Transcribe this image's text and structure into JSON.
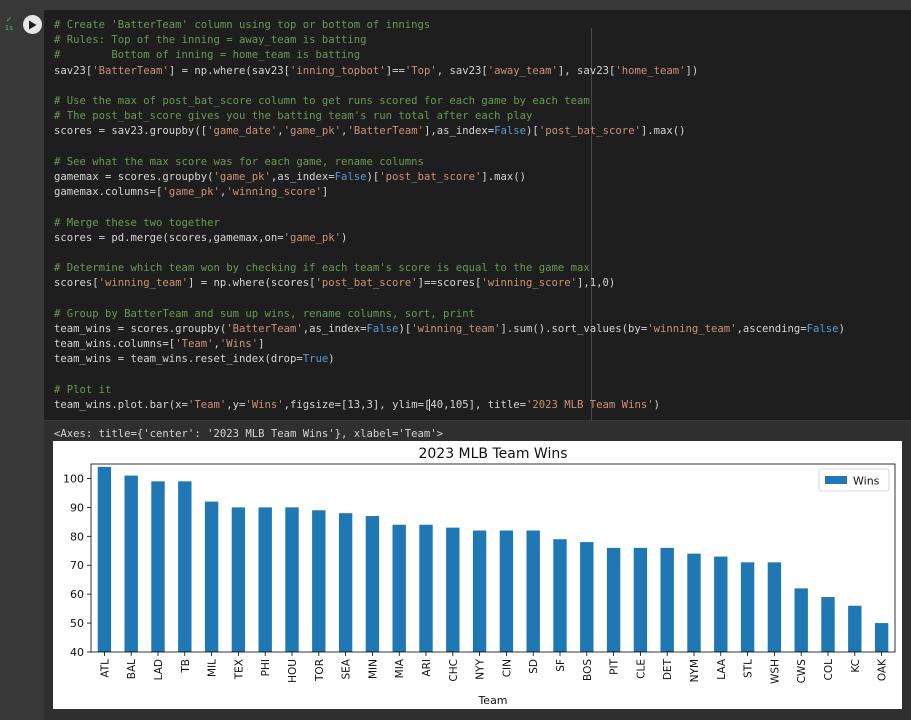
{
  "cell": {
    "exec_time": "1s",
    "lines": [
      {
        "t": "c",
        "v": "# Create 'BatterTeam' column using top or bottom of innings"
      },
      {
        "t": "c",
        "v": "# Rules: Top of the inning = away_team is batting"
      },
      {
        "t": "c",
        "v": "#        Bottom of inning = home_team is batting"
      },
      {
        "t": "code",
        "segs": [
          [
            "sav23[",
            "n"
          ],
          [
            "'BatterTeam'",
            "s"
          ],
          [
            "] = np.where(sav23[",
            "n"
          ],
          [
            "'inning_topbot'",
            "s"
          ],
          [
            "]==",
            "n"
          ],
          [
            "'Top'",
            "s"
          ],
          [
            ", sav23[",
            "n"
          ],
          [
            "'away_team'",
            "s"
          ],
          [
            "], sav23[",
            "n"
          ],
          [
            "'home_team'",
            "s"
          ],
          [
            "])",
            "n"
          ]
        ]
      },
      {
        "t": "blank"
      },
      {
        "t": "c",
        "v": "# Use the max of post_bat_score column to get runs scored for each game by each team"
      },
      {
        "t": "c",
        "v": "# The post_bat_score gives you the batting team's run total after each play"
      },
      {
        "t": "code",
        "segs": [
          [
            "scores = sav23.groupby([",
            "n"
          ],
          [
            "'game_date'",
            "s"
          ],
          [
            ",",
            "n"
          ],
          [
            "'game_pk'",
            "s"
          ],
          [
            ",",
            "n"
          ],
          [
            "'BatterTeam'",
            "s"
          ],
          [
            "],as_index=",
            "n"
          ],
          [
            "False",
            "k"
          ],
          [
            ")[",
            "n"
          ],
          [
            "'post_bat_score'",
            "s"
          ],
          [
            "].max()",
            "n"
          ]
        ]
      },
      {
        "t": "blank"
      },
      {
        "t": "c",
        "v": "# See what the max score was for each game, rename columns"
      },
      {
        "t": "code",
        "segs": [
          [
            "gamemax = scores.groupby(",
            "n"
          ],
          [
            "'game_pk'",
            "s"
          ],
          [
            ",as_index=",
            "n"
          ],
          [
            "False",
            "k"
          ],
          [
            ")[",
            "n"
          ],
          [
            "'post_bat_score'",
            "s"
          ],
          [
            "].max()",
            "n"
          ]
        ]
      },
      {
        "t": "code",
        "segs": [
          [
            "gamemax.columns=[",
            "n"
          ],
          [
            "'game_pk'",
            "s"
          ],
          [
            ",",
            "n"
          ],
          [
            "'winning_score'",
            "s"
          ],
          [
            "]",
            "n"
          ]
        ]
      },
      {
        "t": "blank"
      },
      {
        "t": "c",
        "v": "# Merge these two together"
      },
      {
        "t": "code",
        "segs": [
          [
            "scores = pd.merge(scores,gamemax,on=",
            "n"
          ],
          [
            "'game_pk'",
            "s"
          ],
          [
            ")",
            "n"
          ]
        ]
      },
      {
        "t": "blank"
      },
      {
        "t": "c",
        "v": "# Determine which team won by checking if each team's score is equal to the game max"
      },
      {
        "t": "code",
        "segs": [
          [
            "scores[",
            "n"
          ],
          [
            "'winning_team'",
            "s"
          ],
          [
            "] = np.where(scores[",
            "n"
          ],
          [
            "'post_bat_score'",
            "s"
          ],
          [
            "]==scores[",
            "n"
          ],
          [
            "'winning_score'",
            "s"
          ],
          [
            "],1,0)",
            "n"
          ]
        ]
      },
      {
        "t": "blank"
      },
      {
        "t": "c",
        "v": "# Group by BatterTeam and sum up wins, rename columns, sort, print"
      },
      {
        "t": "code",
        "segs": [
          [
            "team_wins = scores.groupby(",
            "n"
          ],
          [
            "'BatterTeam'",
            "s"
          ],
          [
            ",as_index=",
            "n"
          ],
          [
            "False",
            "k"
          ],
          [
            ")[",
            "n"
          ],
          [
            "'winning_team'",
            "s"
          ],
          [
            "].sum().sort_values(by=",
            "n"
          ],
          [
            "'winning_team'",
            "s"
          ],
          [
            ",ascending=",
            "n"
          ],
          [
            "False",
            "k"
          ],
          [
            ")",
            "n"
          ]
        ]
      },
      {
        "t": "code",
        "segs": [
          [
            "team_wins.columns=[",
            "n"
          ],
          [
            "'Team'",
            "s"
          ],
          [
            ",",
            "n"
          ],
          [
            "'Wins'",
            "s"
          ],
          [
            "]",
            "n"
          ]
        ]
      },
      {
        "t": "code",
        "segs": [
          [
            "team_wins = team_wins.reset_index(drop=",
            "n"
          ],
          [
            "True",
            "k"
          ],
          [
            ")",
            "n"
          ]
        ]
      },
      {
        "t": "blank"
      },
      {
        "t": "c",
        "v": "# Plot it"
      },
      {
        "t": "code",
        "segs": [
          [
            "team_wins.plot.bar(x=",
            "n"
          ],
          [
            "'Team'",
            "s"
          ],
          [
            ",y=",
            "n"
          ],
          [
            "'Wins'",
            "s"
          ],
          [
            ",figsize=[13,3], ylim=[",
            "n"
          ],
          [
            "",
            "cursor"
          ],
          [
            "40,105], title=",
            "n"
          ],
          [
            "'2023 MLB Team Wins'",
            "s"
          ],
          [
            ")",
            "n"
          ]
        ]
      }
    ]
  },
  "output": {
    "repr": "<Axes: title={'center': '2023 MLB Team Wins'}, xlabel='Team'>"
  },
  "colors": {
    "bar": "#1f77b4"
  },
  "chart_data": {
    "type": "bar",
    "title": "2023 MLB Team Wins",
    "xlabel": "Team",
    "ylabel": "",
    "ylim": [
      40,
      105
    ],
    "yticks": [
      40,
      50,
      60,
      70,
      80,
      90,
      100
    ],
    "legend": "top-right",
    "grid": false,
    "categories": [
      "ATL",
      "BAL",
      "LAD",
      "TB",
      "MIL",
      "TEX",
      "PHI",
      "HOU",
      "TOR",
      "SEA",
      "MIN",
      "MIA",
      "ARI",
      "CHC",
      "NYY",
      "CIN",
      "SD",
      "SF",
      "BOS",
      "PIT",
      "CLE",
      "DET",
      "NYM",
      "LAA",
      "STL",
      "WSH",
      "CWS",
      "COL",
      "KC",
      "OAK"
    ],
    "series": [
      {
        "name": "Wins",
        "values": [
          104,
          101,
          99,
          99,
          92,
          90,
          90,
          90,
          89,
          88,
          87,
          84,
          84,
          83,
          82,
          82,
          82,
          79,
          78,
          76,
          76,
          76,
          74,
          73,
          71,
          71,
          62,
          59,
          56,
          50
        ]
      }
    ]
  }
}
